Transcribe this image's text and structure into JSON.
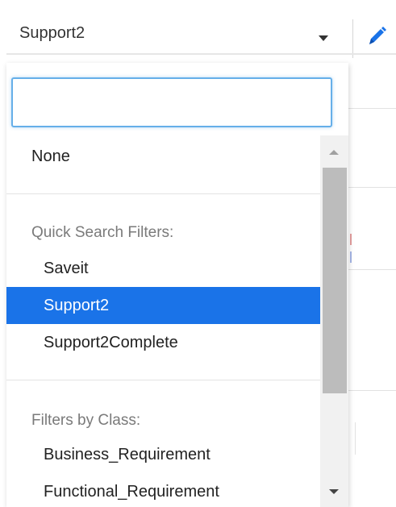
{
  "header": {
    "selected_value": "Support2",
    "edit_icon": "pencil-icon",
    "caret_icon": "caret-down-icon"
  },
  "dropdown": {
    "search": {
      "value": "",
      "placeholder": ""
    },
    "none_option": "None",
    "groups": [
      {
        "label": "Quick Search Filters:",
        "options": [
          "Saveit",
          "Support2",
          "Support2Complete"
        ],
        "selected": "Support2"
      },
      {
        "label": "Filters by Class:",
        "options": [
          "Business_Requirement",
          "Functional_Requirement"
        ]
      }
    ],
    "scrollbar": {
      "up_icon": "scroll-up-arrow-icon",
      "down_icon": "scroll-down-arrow-icon"
    }
  },
  "colors": {
    "selected_bg": "#1a73e8",
    "focus_border": "#66afe9",
    "edit_icon": "#1a73e8"
  }
}
